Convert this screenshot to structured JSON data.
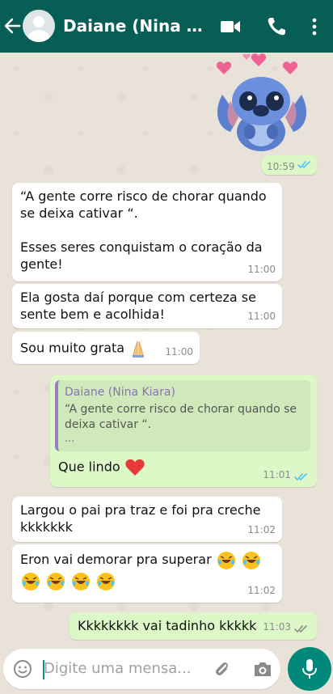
{
  "header": {
    "title": "Daiane (Nina Kiar...",
    "back_icon": "arrow-left-icon",
    "icons": [
      "video-call-icon",
      "phone-icon",
      "more-vert-icon"
    ]
  },
  "messages": [
    {
      "dir": "out",
      "type": "sticker",
      "sticker": "stitch-hearts-sticker",
      "time": "10:59",
      "ticks": "read"
    },
    {
      "dir": "in",
      "text": "“A gente corre risco de chorar quando\nse deixa cativar “.\n\nEsses seres conquistam o coração da\ngente!",
      "time": "11:00"
    },
    {
      "dir": "in",
      "text": "Ela gosta daí porque com certeza se\nsente bem e acolhida!",
      "time": "11:00"
    },
    {
      "dir": "in",
      "text": "Sou muito grata",
      "emoji": "folded-hands",
      "time": "11:00"
    },
    {
      "dir": "out",
      "quote": {
        "author": "Daiane (Nina Kiara)",
        "text": "“A gente corre risco de chorar quando se\ndeixa cativar “.",
        "more": "..."
      },
      "text": "Que lindo",
      "emoji": "red-heart",
      "time": "11:01",
      "ticks": "read"
    },
    {
      "dir": "in",
      "text": "Largou o pai pra traz e foi pra creche\nkkkkkkk",
      "time": "11:02"
    },
    {
      "dir": "in",
      "text": "Eron vai demorar pra superar",
      "emoji": "rolling-laughing x6",
      "time": "11:02"
    },
    {
      "dir": "out",
      "text": "Kkkkkkkk vai tadinho kkkkk",
      "time": "11:03",
      "ticks": "delivered"
    }
  ],
  "composer": {
    "placeholder": "Digite uma mensa...",
    "icons": [
      "emoji-icon",
      "attach-icon",
      "camera-icon",
      "mic-icon"
    ]
  },
  "colors": {
    "header": "#075e54",
    "outgoing": "#dcf8c6",
    "incoming": "#ffffff",
    "read_ticks": "#4fc3f7",
    "mic": "#00897b"
  }
}
